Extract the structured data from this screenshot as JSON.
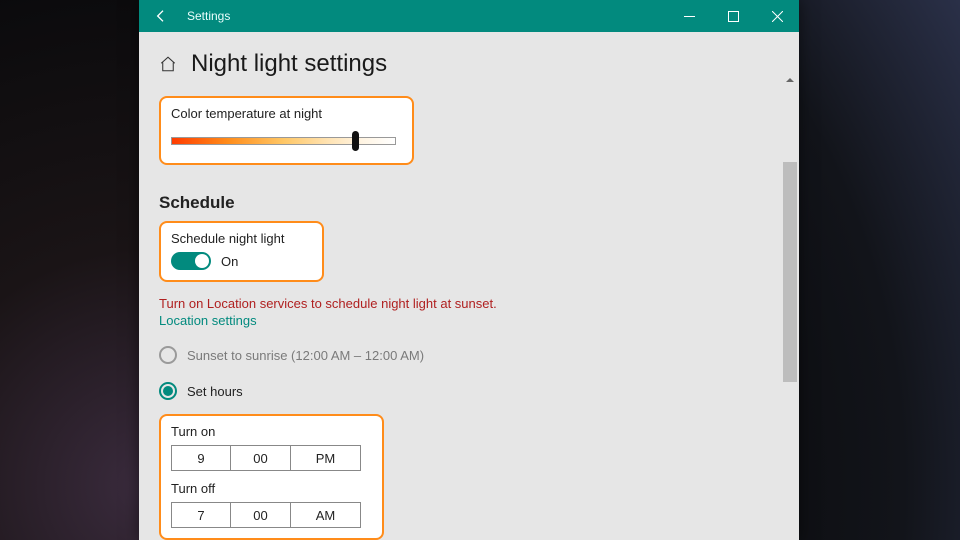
{
  "window": {
    "app_title": "Settings"
  },
  "page": {
    "title": "Night light settings"
  },
  "temp": {
    "label": "Color temperature at night",
    "value_pct": 83
  },
  "schedule": {
    "heading": "Schedule",
    "toggle_label": "Schedule night light",
    "toggle_state": "On",
    "warning": "Turn on Location services to schedule night light at sunset.",
    "link": "Location settings",
    "option_sunset": "Sunset to sunrise (12:00 AM – 12:00 AM)",
    "option_sethours": "Set hours",
    "turn_on_label": "Turn on",
    "turn_on": {
      "hour": "9",
      "minute": "00",
      "ampm": "PM"
    },
    "turn_off_label": "Turn off",
    "turn_off": {
      "hour": "7",
      "minute": "00",
      "ampm": "AM"
    }
  }
}
